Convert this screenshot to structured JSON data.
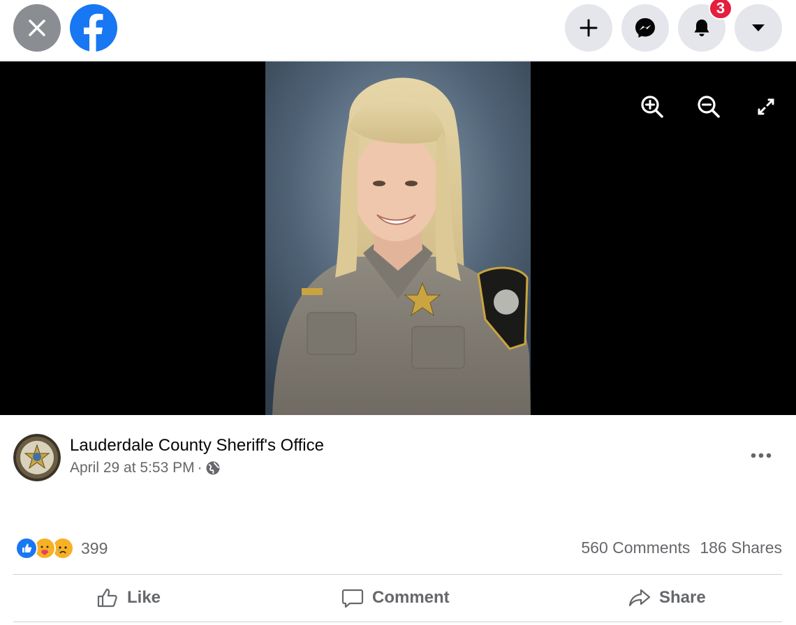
{
  "topbar": {
    "notifications_badge": "3",
    "icons": [
      "close-icon",
      "facebook-logo",
      "plus-icon",
      "messenger-icon",
      "bell-icon",
      "caret-down-icon"
    ]
  },
  "viewer": {
    "tools": [
      "zoom-in-icon",
      "zoom-out-icon",
      "fullscreen-icon"
    ]
  },
  "post": {
    "page_name": "Lauderdale County Sheriff's Office",
    "timestamp": "April 29 at 5:53 PM",
    "separator": "·",
    "reaction_count": "399",
    "comments": "560 Comments",
    "shares": "186 Shares",
    "actions": {
      "like": "Like",
      "comment": "Comment",
      "share": "Share"
    }
  },
  "colors": {
    "brand": "#1877f2",
    "badge": "#e41e3f",
    "secondary_text": "#65676b"
  }
}
